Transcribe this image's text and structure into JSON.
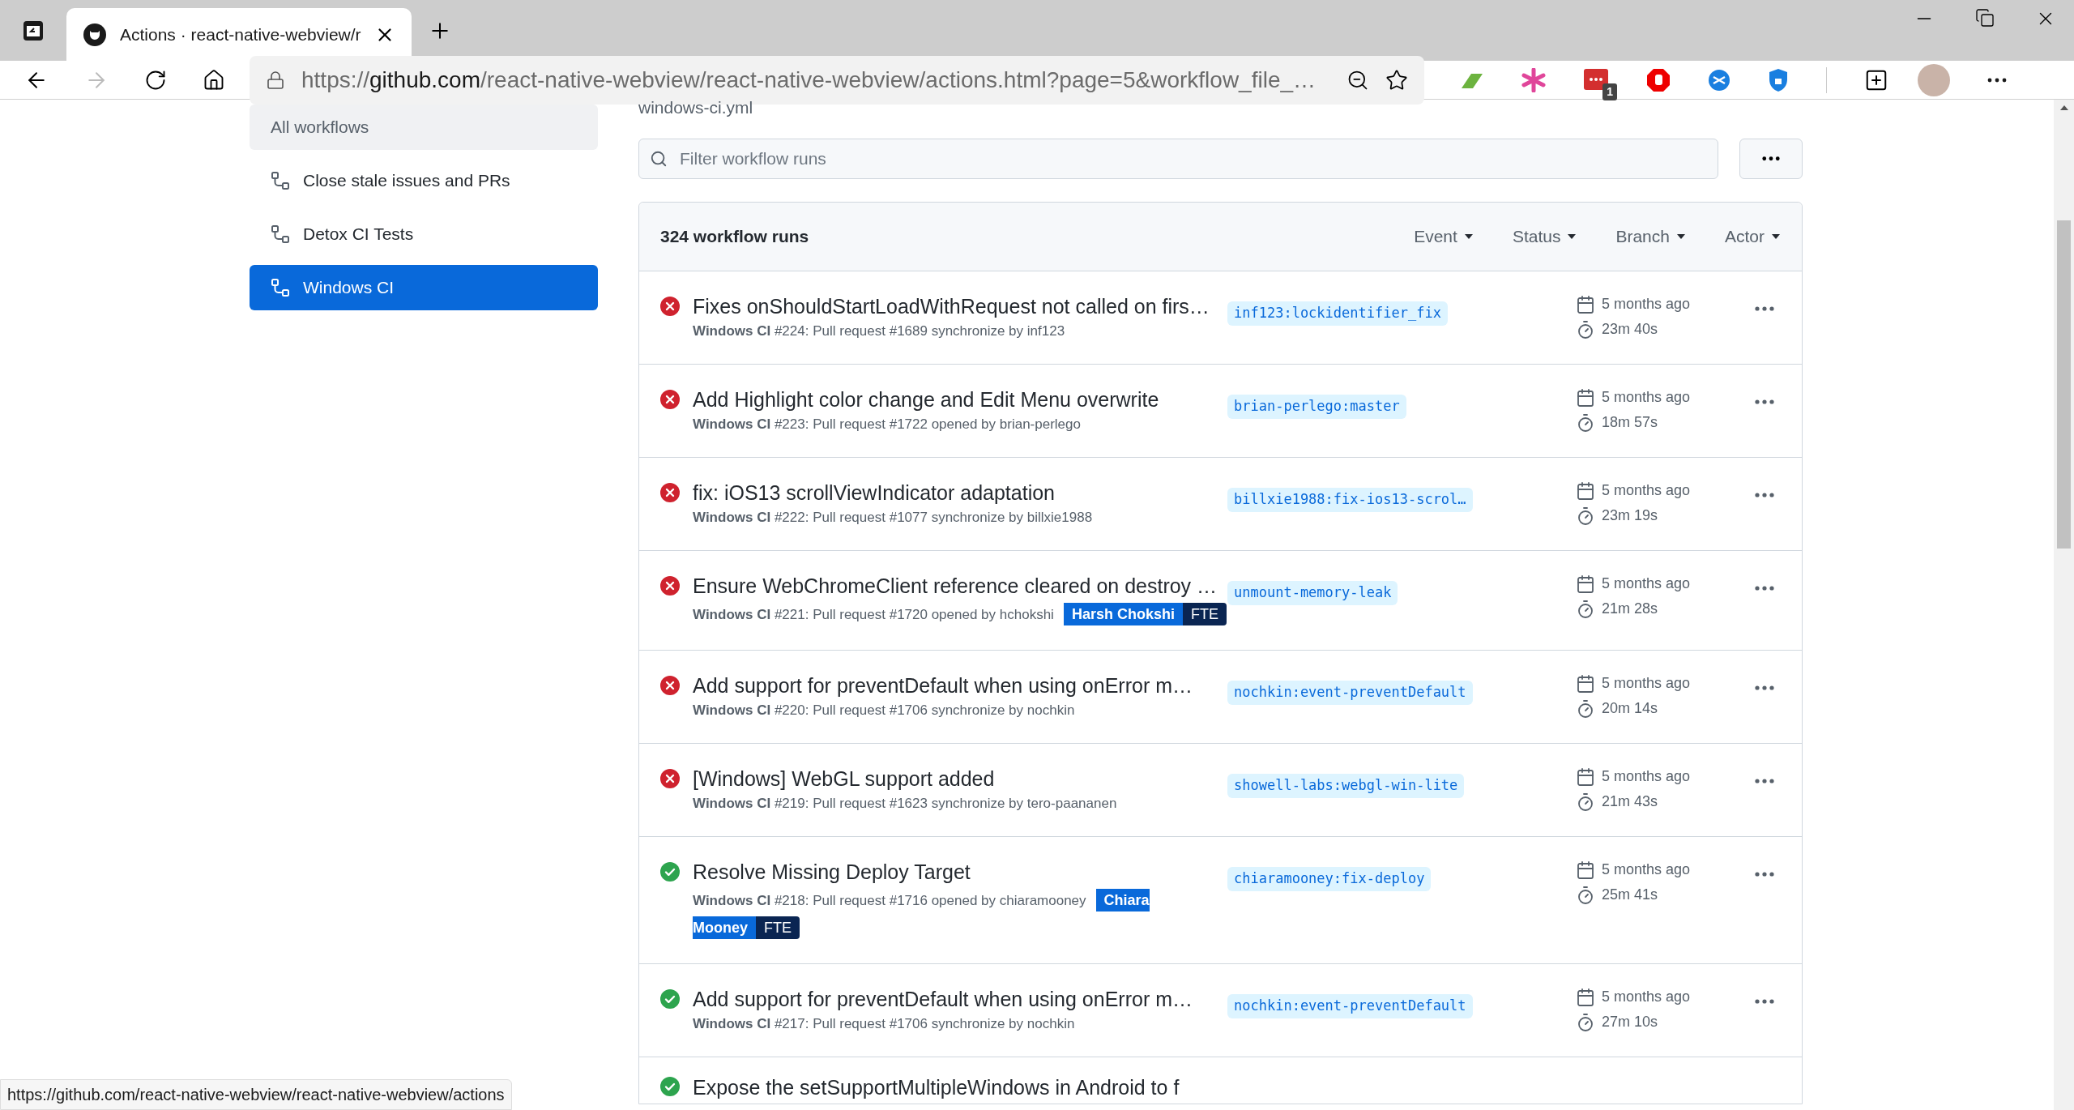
{
  "browser": {
    "tab": {
      "title": "Actions · react-native-webview/r",
      "selected": true
    },
    "url": {
      "scheme": "https://",
      "host": "github.com",
      "rest": "/react-native-webview/react-native-webview/actions.html?page=5&workflow_file_…"
    },
    "extension_badge": "1"
  },
  "sidebar": {
    "items": [
      {
        "kind": "all",
        "label": "All workflows",
        "selected": false
      },
      {
        "kind": "workflow",
        "label": "Close stale issues and PRs",
        "selected": false
      },
      {
        "kind": "workflow",
        "label": "Detox CI Tests",
        "selected": false
      },
      {
        "kind": "workflow",
        "label": "Windows CI",
        "selected": true
      }
    ]
  },
  "main": {
    "file_name": "windows-ci.yml",
    "filter": {
      "placeholder": "Filter workflow runs"
    },
    "table": {
      "count": "324 workflow runs",
      "filters": [
        "Event",
        "Status",
        "Branch",
        "Actor"
      ],
      "runs": [
        {
          "failed": true,
          "title": "Fixes onShouldStartLoadWithRequest not called on firs…",
          "workflow": "Windows CI",
          "detail": " #224: Pull request #1689 synchronize by inf123",
          "branch": "inf123:lockidentifier_fix",
          "time": "5 months ago",
          "duration": "23m 40s"
        },
        {
          "failed": true,
          "title": "Add Highlight color change and Edit Menu overwrite",
          "workflow": "Windows CI",
          "detail": " #223: Pull request #1722 opened by brian-perlego",
          "branch": "brian-perlego:master",
          "time": "5 months ago",
          "duration": "18m 57s"
        },
        {
          "failed": true,
          "title": "fix: iOS13 scrollViewIndicator adaptation",
          "workflow": "Windows CI",
          "detail": " #222: Pull request #1077 synchronize by billxie1988",
          "branch": "billxie1988:fix-ios13-scrol…",
          "time": "5 months ago",
          "duration": "23m 19s"
        },
        {
          "failed": true,
          "title": "Ensure WebChromeClient reference cleared on destroy …",
          "workflow": "Windows CI",
          "detail": " #221: Pull request #1720 opened by hchokshi",
          "badges": [
            {
              "kind": "name",
              "label": "Harsh Chokshi"
            },
            {
              "kind": "role",
              "label": "FTE"
            }
          ],
          "branch": "unmount-memory-leak",
          "time": "5 months ago",
          "duration": "21m 28s"
        },
        {
          "failed": true,
          "title": "Add support for preventDefault when using onError m…",
          "workflow": "Windows CI",
          "detail": " #220: Pull request #1706 synchronize by nochkin",
          "branch": "nochkin:event-preventDefault",
          "time": "5 months ago",
          "duration": "20m 14s"
        },
        {
          "failed": true,
          "title": "[Windows] WebGL support added",
          "workflow": "Windows CI",
          "detail": " #219: Pull request #1623 synchronize by tero-paananen",
          "branch": "showell-labs:webgl-win-lite",
          "time": "5 months ago",
          "duration": "21m 43s"
        },
        {
          "failed": false,
          "title": "Resolve Missing Deploy Target",
          "workflow": "Windows CI",
          "detail": " #218: Pull request #1716 opened by chiaramooney",
          "badges": [
            {
              "kind": "name",
              "label": "Chiara Mooney"
            },
            {
              "kind": "role",
              "label": "FTE"
            }
          ],
          "branch": "chiaramooney:fix-deploy",
          "time": "5 months ago",
          "duration": "25m 41s"
        },
        {
          "failed": false,
          "title": "Add support for preventDefault when using onError m…",
          "workflow": "Windows CI",
          "detail": " #217: Pull request #1706 synchronize by nochkin",
          "branch": "nochkin:event-preventDefault",
          "time": "5 months ago",
          "duration": "27m 10s"
        },
        {
          "failed": false,
          "title": "Expose the setSupportMultipleWindows in Android to f"
        }
      ]
    }
  },
  "status_bar": {
    "link": "https://github.com/react-native-webview/react-native-webview/actions"
  }
}
